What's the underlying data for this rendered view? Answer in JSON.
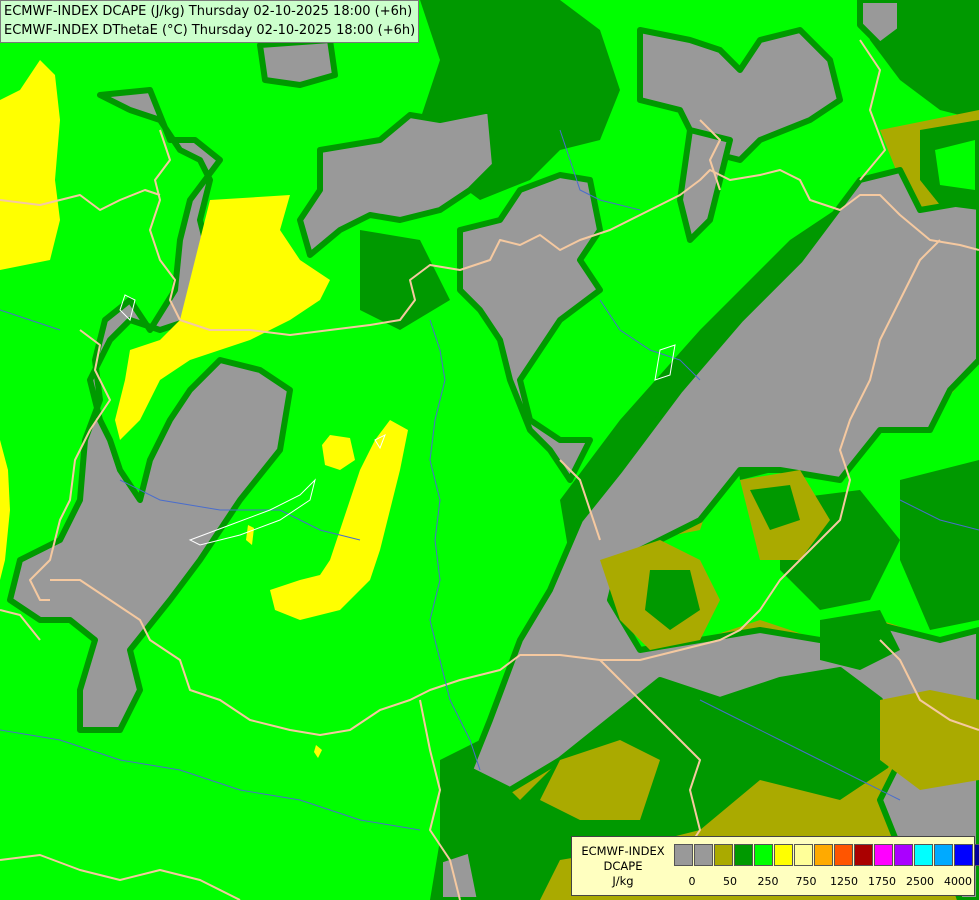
{
  "title": {
    "line1": "ECMWF-INDEX DCAPE (J/kg) Thursday 02-10-2025 18:00 (+6h)",
    "line2": "ECMWF-INDEX DThetaE (°C) Thursday 02-10-2025 18:00 (+6h)"
  },
  "legend": {
    "title_line1": "ECMWF-INDEX",
    "title_line2": "DCAPE",
    "title_line3": "J/kg",
    "colors": [
      "#999999",
      "#999999",
      "#aaaa00",
      "#009900",
      "#00ff00",
      "#ffff00",
      "#ffff99",
      "#ffaa00",
      "#ff5500",
      "#aa0000",
      "#ff00ff",
      "#aa00ff",
      "#00ffff",
      "#00aaff",
      "#0000ff",
      "#000099"
    ],
    "tick_labels": [
      "0",
      "50",
      "250",
      "750",
      "1250",
      "1750",
      "2500",
      "4000"
    ]
  },
  "map_colors": {
    "gray": "#999999",
    "olive": "#aaaa00",
    "dark_green": "#009900",
    "light_green": "#00ff00",
    "yellow": "#ffff00",
    "border_line": "#f5c9a0",
    "river_line": "#4a6dcc",
    "lake_line": "#ffffff"
  }
}
